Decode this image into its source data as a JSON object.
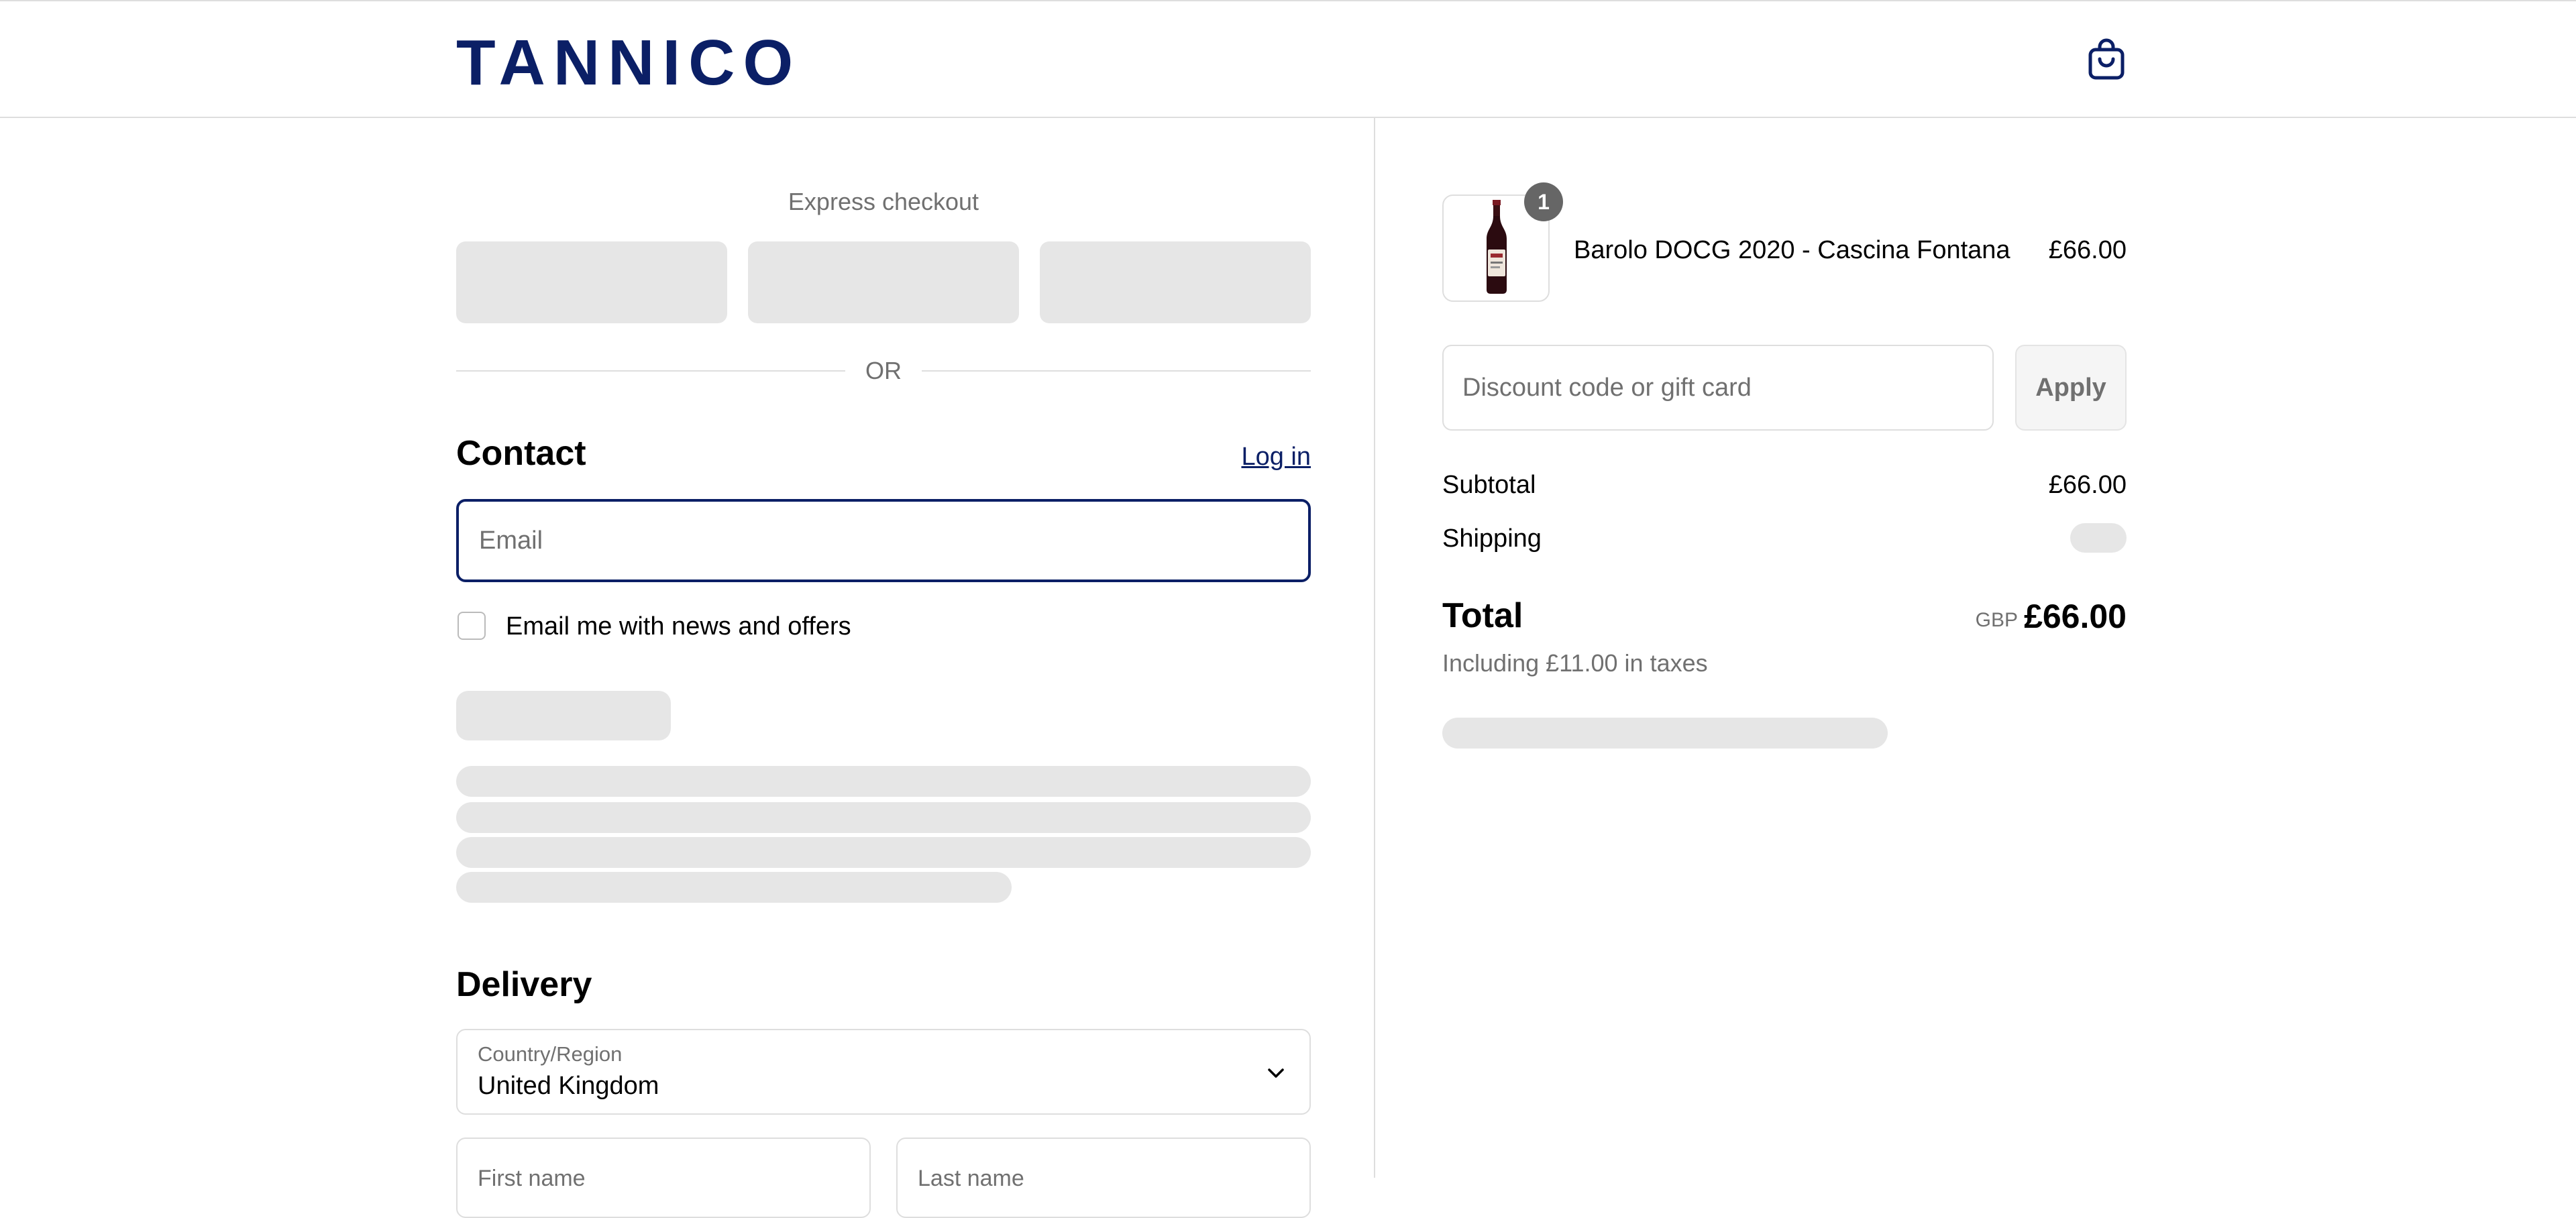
{
  "header": {
    "logo_text": "TANNICO",
    "cart_icon": "shopping-bag-icon"
  },
  "express_checkout": {
    "title": "Express checkout",
    "buttons_loading": 3,
    "or_text": "OR"
  },
  "contact": {
    "title": "Contact",
    "login_link": "Log in",
    "email_placeholder": "Email",
    "newsletter_label": "Email me with news and offers"
  },
  "delivery": {
    "title": "Delivery",
    "country_label": "Country/Region",
    "country_value": "United Kingdom",
    "first_name_placeholder": "First name",
    "last_name_placeholder": "Last name"
  },
  "order_summary": {
    "item": {
      "name": "Barolo DOCG 2020 - Cascina Fontana",
      "price": "£66.00",
      "quantity": "1"
    },
    "discount_placeholder": "Discount code or gift card",
    "apply_label": "Apply",
    "subtotal_label": "Subtotal",
    "subtotal_value": "£66.00",
    "shipping_label": "Shipping",
    "total_label": "Total",
    "total_currency": "GBP",
    "total_value": "£66.00",
    "taxes_text": "Including £11.00 in taxes"
  },
  "colors": {
    "brand": "#0b1f66",
    "skeleton": "#e6e6e6",
    "muted_text": "#707070",
    "border": "#dedede"
  }
}
